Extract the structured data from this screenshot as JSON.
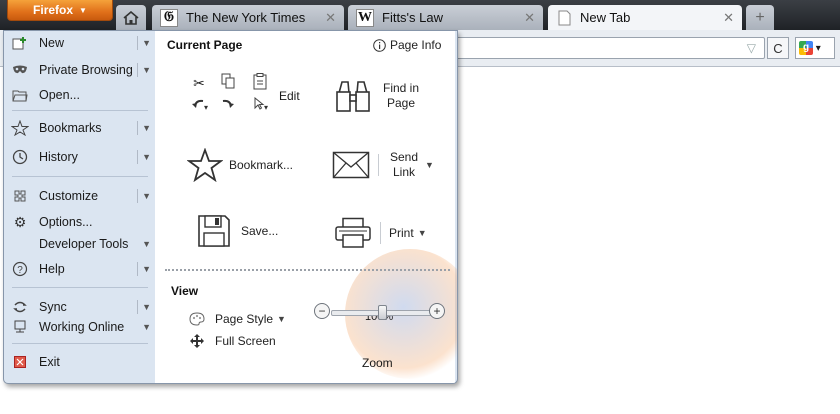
{
  "app": {
    "menu_button": "Firefox"
  },
  "tabs": [
    {
      "title": "The New York Times",
      "favicon": "nyt-icon",
      "active": false
    },
    {
      "title": "Fitts's Law",
      "favicon": "wikipedia-icon",
      "active": false
    },
    {
      "title": "New Tab",
      "favicon": "blank-page-icon",
      "active": true
    }
  ],
  "menu": {
    "left": [
      {
        "label": "New",
        "icon": "new-tab-icon",
        "submenu": true
      },
      {
        "label": "Private Browsing",
        "icon": "mask-icon",
        "submenu": true
      },
      {
        "label": "Open...",
        "icon": "folder-icon",
        "submenu": false
      },
      {
        "label": "Bookmarks",
        "icon": "bookmarks-star-icon",
        "submenu": true
      },
      {
        "label": "History",
        "icon": "clock-icon",
        "submenu": true
      },
      {
        "label": "Customize",
        "icon": "customize-icon",
        "submenu": true
      },
      {
        "label": "Options...",
        "icon": "gear-icon",
        "submenu": false
      },
      {
        "label": "Developer Tools",
        "icon": "",
        "submenu": true
      },
      {
        "label": "Help",
        "icon": "help-icon",
        "submenu": true
      },
      {
        "label": "Sync",
        "icon": "sync-icon",
        "submenu": true
      },
      {
        "label": "Working Online",
        "icon": "network-icon",
        "submenu": true
      },
      {
        "label": "Exit",
        "icon": "exit-icon",
        "submenu": false
      }
    ],
    "current_page": {
      "title": "Current Page",
      "page_info": "Page Info",
      "edit": "Edit",
      "find": "Find in Page",
      "bookmark": "Bookmark...",
      "send_link": "Send Link",
      "save": "Save...",
      "print": "Print"
    },
    "view": {
      "title": "View",
      "page_style": "Page Style",
      "full_screen": "Full Screen",
      "zoom_value": "100%",
      "zoom_fraction": 0.5,
      "zoom_label": "Zoom"
    }
  }
}
